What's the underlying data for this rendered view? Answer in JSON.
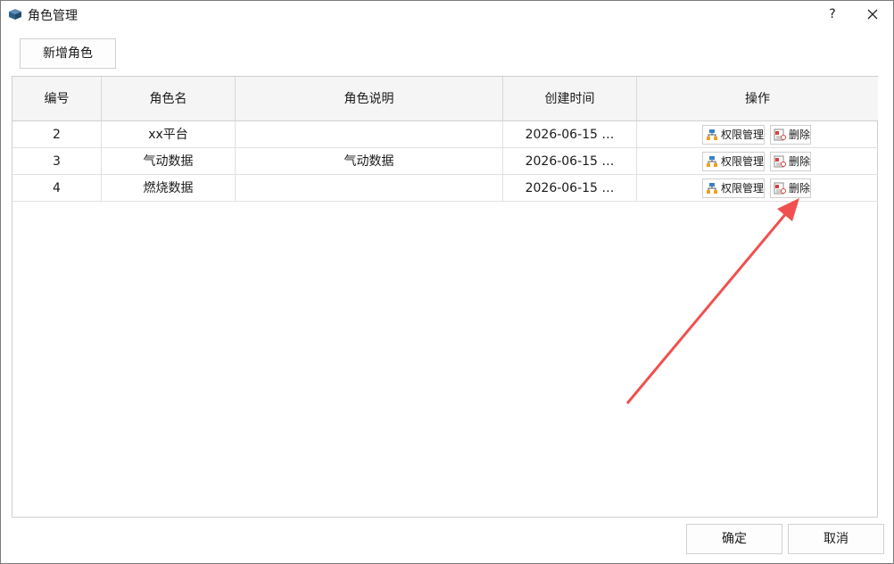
{
  "window": {
    "title": "角色管理",
    "help": "?"
  },
  "toolbar": {
    "add_label": "新增角色"
  },
  "table": {
    "headers": [
      "编号",
      "角色名",
      "角色说明",
      "创建时间",
      "操作"
    ],
    "rows": [
      {
        "id": "2",
        "name": "xx平台",
        "desc": "",
        "created": "2026-06-15 …"
      },
      {
        "id": "3",
        "name": "气动数据",
        "desc": "气动数据",
        "created": "2026-06-15 …"
      },
      {
        "id": "4",
        "name": "燃烧数据",
        "desc": "",
        "created": "2026-06-15 …"
      }
    ],
    "actions": {
      "permission_label": "权限管理",
      "delete_label": "删除"
    }
  },
  "footer": {
    "ok_label": "确定",
    "cancel_label": "取消"
  },
  "colors": {
    "annotation_arrow": "#f0504f"
  }
}
